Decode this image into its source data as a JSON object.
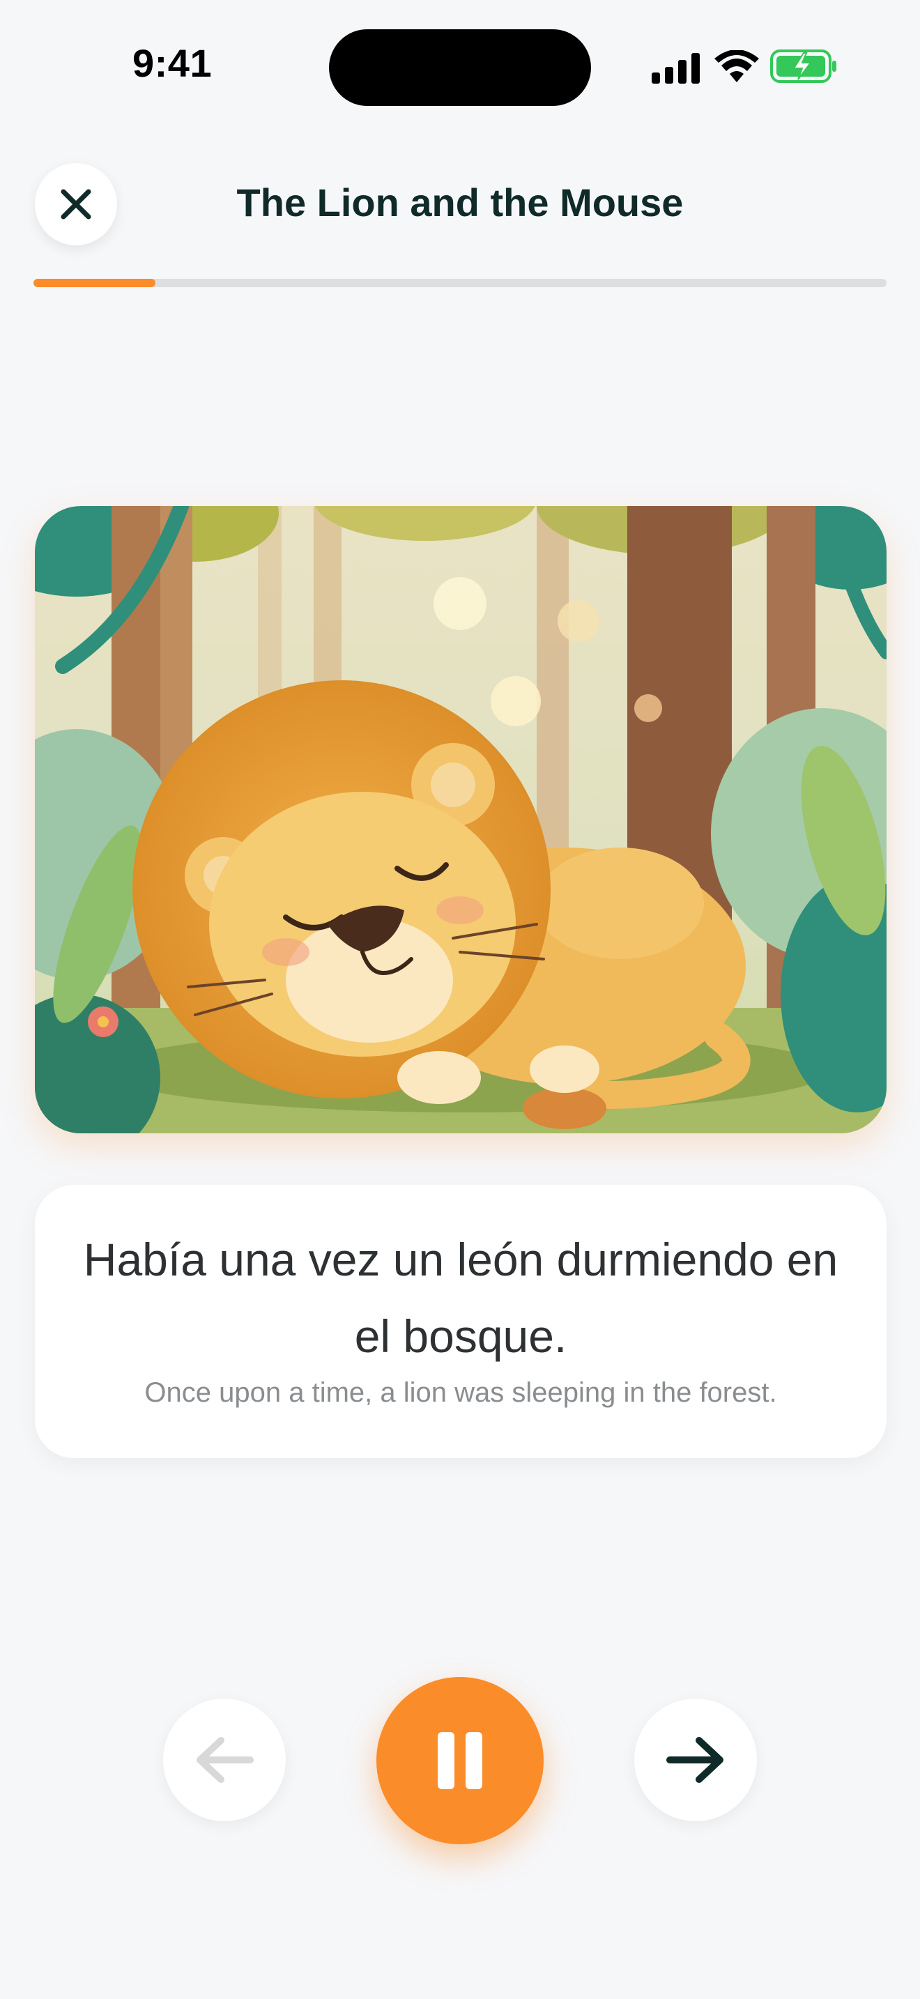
{
  "status_bar": {
    "time": "9:41",
    "icons": [
      "signal-icon",
      "wifi-icon",
      "battery-charging-icon"
    ]
  },
  "header": {
    "close_icon": "close-icon",
    "title": "The Lion and the Mouse"
  },
  "progress": {
    "fraction": 0.143,
    "color": "#fb8c2a"
  },
  "page": {
    "illustration": "sleeping-lion-in-forest",
    "spanish_text": "Había una vez un león durmiendo en el bosque.",
    "english_text": "Once upon a time, a lion was sleeping in the forest."
  },
  "controls": {
    "prev_icon": "arrow-left-icon",
    "play_pause_icon": "pause-icon",
    "next_icon": "arrow-right-icon",
    "accent_color": "#fb8c2a"
  }
}
